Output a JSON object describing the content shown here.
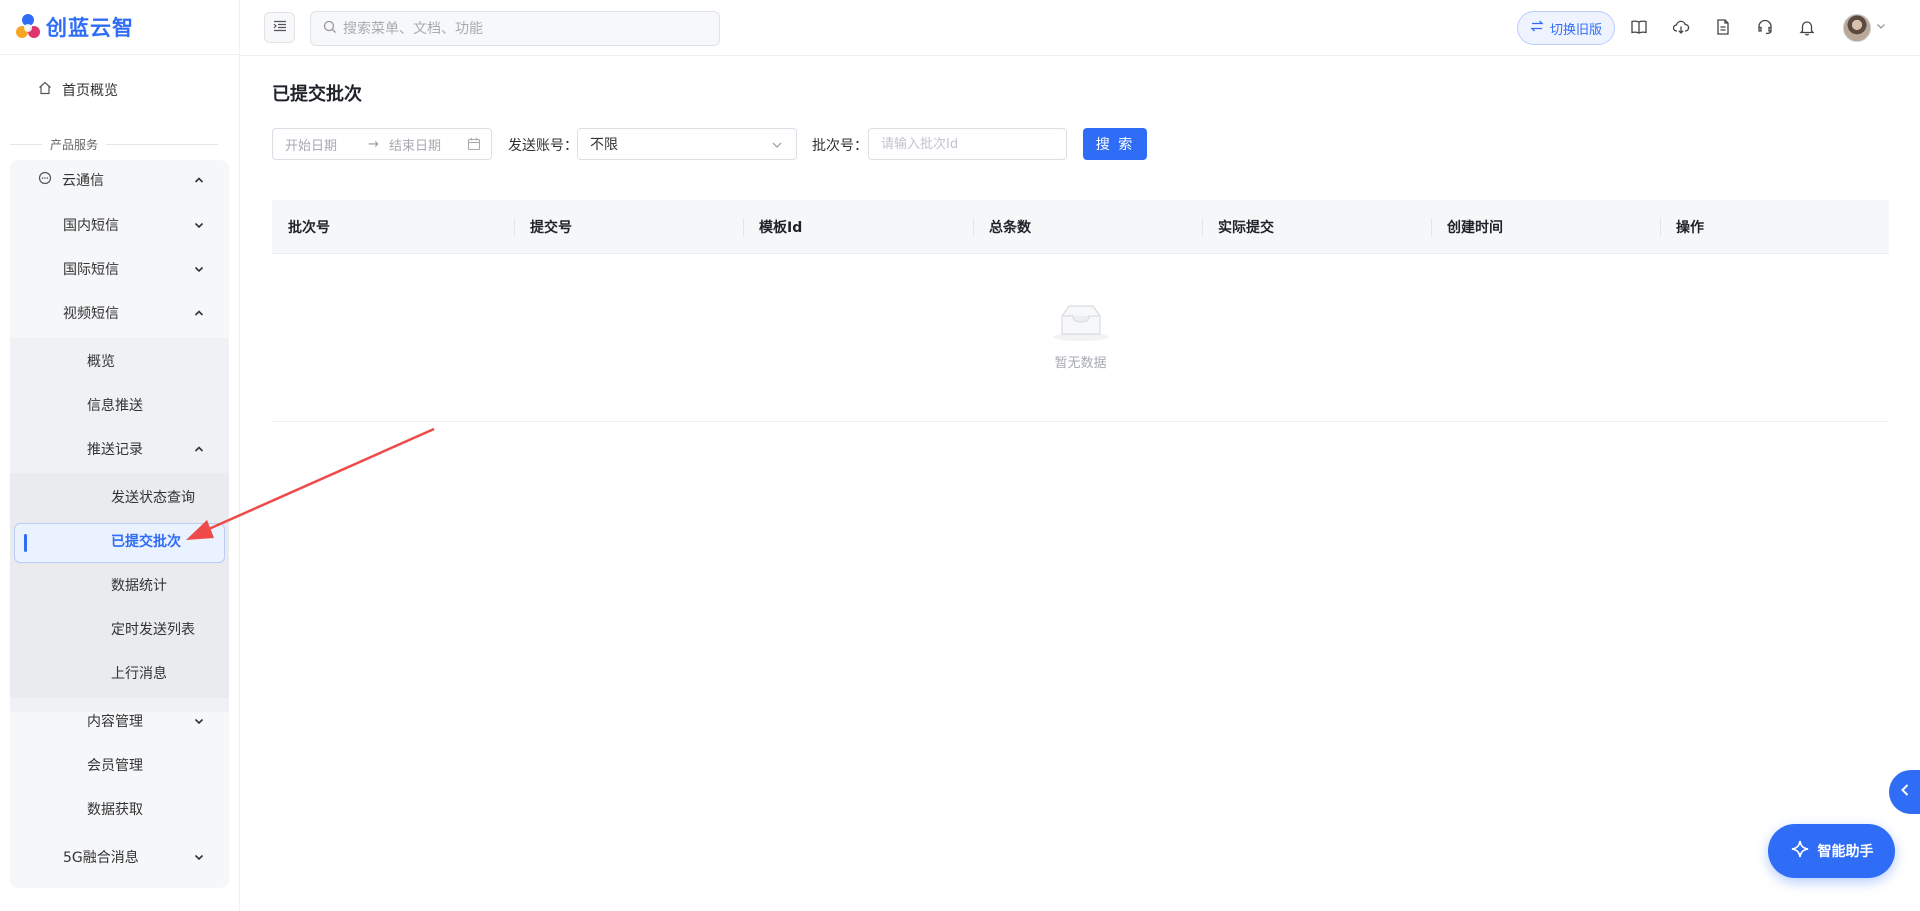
{
  "app": {
    "logo_text": "创蓝云智"
  },
  "header": {
    "search_placeholder": "搜索菜单、文档、功能",
    "switch_label": "切换旧版",
    "icons": [
      "book-icon",
      "cloud-download-icon",
      "document-icon",
      "headset-icon",
      "bell-icon"
    ]
  },
  "sidebar": {
    "home": "首页概览",
    "section": "产品服务",
    "cloud_msg": "云通信",
    "domestic_sms": "国内短信",
    "intl_sms": "国际短信",
    "video_sms": "视频短信",
    "overview": "概览",
    "push": "信息推送",
    "push_records": "推送记录",
    "status_query": "发送状态查询",
    "submitted_batches": "已提交批次",
    "stats": "数据统计",
    "scheduled": "定时发送列表",
    "inbound": "上行消息",
    "content_mgmt": "内容管理",
    "member_mgmt": "会员管理",
    "data_fetch": "数据获取",
    "fusion_5g": "5G融合消息"
  },
  "page": {
    "title": "已提交批次",
    "date_start_placeholder": "开始日期",
    "date_arrow": "→",
    "date_end_placeholder": "结束日期",
    "account_label": "发送账号：",
    "account_value": "不限",
    "batch_label": "批次号：",
    "batch_placeholder": "请输入批次Id",
    "search_button": "搜 索"
  },
  "table": {
    "columns": [
      "批次号",
      "提交号",
      "模板Id",
      "总条数",
      "实际提交",
      "创建时间",
      "操作"
    ],
    "empty_text": "暂无数据"
  },
  "assistant": {
    "label": "智能助手"
  },
  "colors": {
    "accent": "#2f6df6",
    "annotation_arrow": "#ef4a4a"
  }
}
